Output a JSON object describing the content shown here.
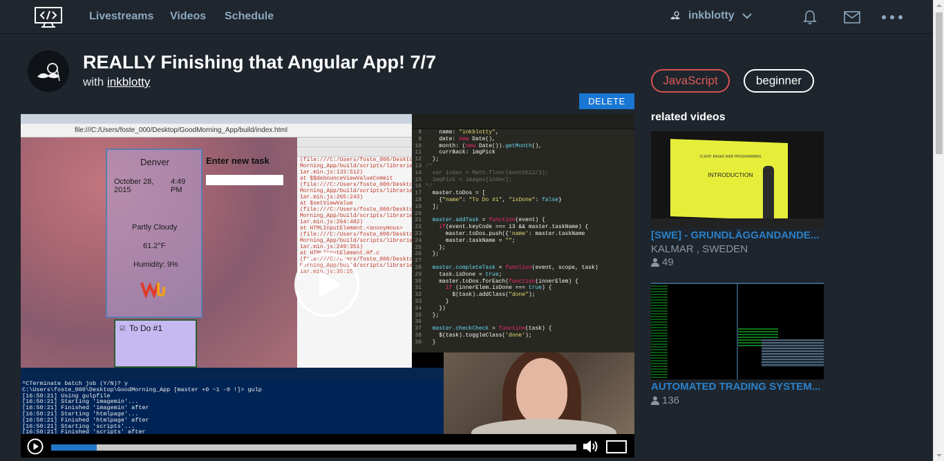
{
  "nav": {
    "links": [
      "Livestreams",
      "Videos",
      "Schedule"
    ],
    "username": "inkblotty"
  },
  "stream": {
    "title": "REALLY Finishing that Angular App! 7/7",
    "with_label": "with",
    "host": "inkblotty",
    "delete_label": "DELETE"
  },
  "tags": [
    "JavaScript",
    "beginner"
  ],
  "related": {
    "heading": "related videos",
    "items": [
      {
        "title": "[SWE] - GRUNDLÄGGANDANDE...",
        "location": "KALMAR , SWEDEN",
        "views": "49",
        "thumb_text": [
          "CLIENT BASED WEB PROGRAMMING",
          "INTRODUCTION"
        ]
      },
      {
        "title": "AUTOMATED TRADING SYSTEM...",
        "location": "",
        "views": "136"
      }
    ]
  },
  "player": {
    "progress": 0.087,
    "browser_url": "file:///C:/Users/foste_000/Desktop/GoodMorning_App/build/index.html",
    "weather": {
      "city": "Denver",
      "date": "October 28, 2015",
      "time": "4:49 PM",
      "condition": "Partly Cloudy",
      "temp": "61.2°F",
      "humidity": "Humidity: 9%"
    },
    "enter_task": "Enter new task",
    "todo": "To Do #1",
    "terminal_lines": [
      "^CTerminate batch job (Y/N)? y",
      "C:\\Users\\foste_000\\Desktop\\GoodMorning_App [master +0 ~1 -0 !]> gulp",
      "[16:50:21] Using gulpfile",
      "[16:50:21] Starting 'imagemin'...",
      "[16:50:21] Finished 'imagemin' after",
      "[16:50:21] Starting 'htmlpage'...",
      "[16:50:21] Finished 'htmlpage' after",
      "[16:50:21] Starting 'scripts'...",
      "[16:50:21] Finished 'scripts' after"
    ]
  },
  "colors": {
    "accent": "#2a80c9",
    "delete": "#1976d2",
    "js_tag": "#d9534f"
  }
}
